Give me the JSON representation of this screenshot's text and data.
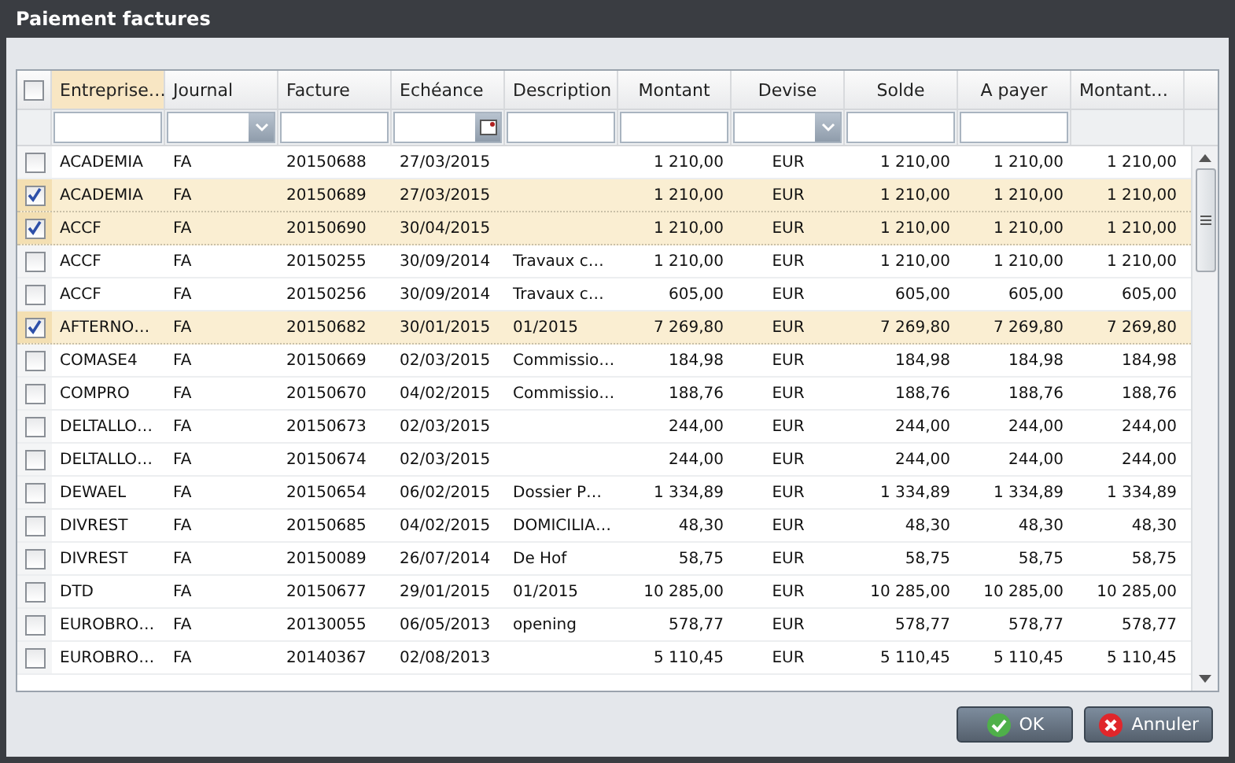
{
  "window": {
    "title": "Paiement factures"
  },
  "table": {
    "select_all": {
      "checked": false
    },
    "columns": [
      {
        "label": "Entreprise…",
        "sorted": true,
        "header_centered": false,
        "numeric": false,
        "centered": false,
        "filter": {
          "kind": "text"
        }
      },
      {
        "label": "Journal",
        "sorted": false,
        "header_centered": false,
        "numeric": false,
        "centered": false,
        "filter": {
          "kind": "select"
        }
      },
      {
        "label": "Facture",
        "sorted": false,
        "header_centered": false,
        "numeric": false,
        "centered": false,
        "filter": {
          "kind": "text"
        }
      },
      {
        "label": "Echéance",
        "sorted": false,
        "header_centered": false,
        "numeric": false,
        "centered": false,
        "filter": {
          "kind": "date"
        }
      },
      {
        "label": "Description",
        "sorted": false,
        "header_centered": false,
        "numeric": false,
        "centered": false,
        "filter": {
          "kind": "text"
        }
      },
      {
        "label": "Montant",
        "sorted": false,
        "header_centered": true,
        "numeric": true,
        "centered": false,
        "filter": {
          "kind": "text"
        }
      },
      {
        "label": "Devise",
        "sorted": false,
        "header_centered": true,
        "numeric": false,
        "centered": true,
        "filter": {
          "kind": "select"
        }
      },
      {
        "label": "Solde",
        "sorted": false,
        "header_centered": true,
        "numeric": true,
        "centered": false,
        "filter": {
          "kind": "text"
        }
      },
      {
        "label": "A payer",
        "sorted": false,
        "header_centered": true,
        "numeric": true,
        "centered": false,
        "filter": {
          "kind": "text"
        }
      },
      {
        "label": "Montant…",
        "sorted": false,
        "header_centered": false,
        "numeric": true,
        "centered": false
      }
    ],
    "rows": [
      {
        "checked": false,
        "cells": [
          "ACADEMIA",
          "FA",
          "20150688",
          "27/03/2015",
          "",
          "1 210,00",
          "EUR",
          "1 210,00",
          "1 210,00",
          "1 210,00"
        ]
      },
      {
        "checked": true,
        "cells": [
          "ACADEMIA",
          "FA",
          "20150689",
          "27/03/2015",
          "",
          "1 210,00",
          "EUR",
          "1 210,00",
          "1 210,00",
          "1 210,00"
        ]
      },
      {
        "checked": true,
        "cells": [
          "ACCF",
          "FA",
          "20150690",
          "30/04/2015",
          "",
          "1 210,00",
          "EUR",
          "1 210,00",
          "1 210,00",
          "1 210,00"
        ]
      },
      {
        "checked": false,
        "cells": [
          "ACCF",
          "FA",
          "20150255",
          "30/09/2014",
          "Travaux c…",
          "1 210,00",
          "EUR",
          "1 210,00",
          "1 210,00",
          "1 210,00"
        ]
      },
      {
        "checked": false,
        "cells": [
          "ACCF",
          "FA",
          "20150256",
          "30/09/2014",
          "Travaux c…",
          "605,00",
          "EUR",
          "605,00",
          "605,00",
          "605,00"
        ]
      },
      {
        "checked": true,
        "cells": [
          "AFTERNO…",
          "FA",
          "20150682",
          "30/01/2015",
          "01/2015",
          "7 269,80",
          "EUR",
          "7 269,80",
          "7 269,80",
          "7 269,80"
        ]
      },
      {
        "checked": false,
        "cells": [
          "COMASE4",
          "FA",
          "20150669",
          "02/03/2015",
          "Commissio…",
          "184,98",
          "EUR",
          "184,98",
          "184,98",
          "184,98"
        ]
      },
      {
        "checked": false,
        "cells": [
          "COMPRO",
          "FA",
          "20150670",
          "04/02/2015",
          "Commissio…",
          "188,76",
          "EUR",
          "188,76",
          "188,76",
          "188,76"
        ]
      },
      {
        "checked": false,
        "cells": [
          "DELTALLO…",
          "FA",
          "20150673",
          "02/03/2015",
          "",
          "244,00",
          "EUR",
          "244,00",
          "244,00",
          "244,00"
        ]
      },
      {
        "checked": false,
        "cells": [
          "DELTALLO…",
          "FA",
          "20150674",
          "02/03/2015",
          "",
          "244,00",
          "EUR",
          "244,00",
          "244,00",
          "244,00"
        ]
      },
      {
        "checked": false,
        "cells": [
          "DEWAEL",
          "FA",
          "20150654",
          "06/02/2015",
          "Dossier P…",
          "1 334,89",
          "EUR",
          "1 334,89",
          "1 334,89",
          "1 334,89"
        ]
      },
      {
        "checked": false,
        "cells": [
          "DIVREST",
          "FA",
          "20150685",
          "04/02/2015",
          "DOMICILIA…",
          "48,30",
          "EUR",
          "48,30",
          "48,30",
          "48,30"
        ]
      },
      {
        "checked": false,
        "cells": [
          "DIVREST",
          "FA",
          "20150089",
          "26/07/2014",
          "De Hof",
          "58,75",
          "EUR",
          "58,75",
          "58,75",
          "58,75"
        ]
      },
      {
        "checked": false,
        "cells": [
          "DTD",
          "FA",
          "20150677",
          "29/01/2015",
          "01/2015",
          "10 285,00",
          "EUR",
          "10 285,00",
          "10 285,00",
          "10 285,00"
        ]
      },
      {
        "checked": false,
        "cells": [
          "EUROBRO…",
          "FA",
          "20130055",
          "06/05/2013",
          "opening",
          "578,77",
          "EUR",
          "578,77",
          "578,77",
          "578,77"
        ]
      },
      {
        "checked": false,
        "cells": [
          "EUROBRO…",
          "FA",
          "20140367",
          "02/08/2013",
          "",
          "5 110,45",
          "EUR",
          "5 110,45",
          "5 110,45",
          "5 110,45"
        ]
      }
    ]
  },
  "buttons": [
    {
      "label": "OK",
      "kind": "ok"
    },
    {
      "label": "Annuler",
      "kind": "cancel"
    }
  ]
}
